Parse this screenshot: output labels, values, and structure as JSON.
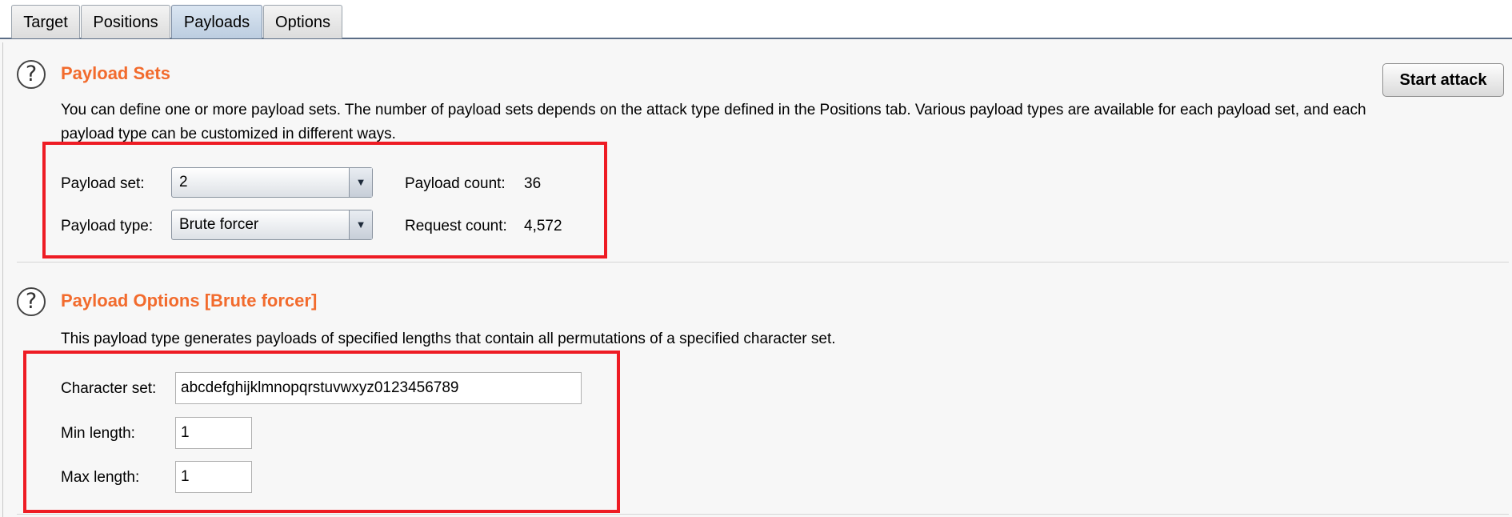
{
  "tabs": [
    {
      "label": "Target"
    },
    {
      "label": "Positions"
    },
    {
      "label": "Payloads",
      "active": true
    },
    {
      "label": "Options"
    }
  ],
  "start_attack_label": "Start attack",
  "payload_sets": {
    "title": "Payload Sets",
    "description": "You can define one or more payload sets. The number of payload sets depends on the attack type defined in the Positions tab. Various payload types are available for each payload set, and each payload type can be customized in different ways.",
    "payload_set_label": "Payload set:",
    "payload_set_value": "2",
    "payload_type_label": "Payload type:",
    "payload_type_value": "Brute forcer",
    "payload_count_label": "Payload count:",
    "payload_count_value": "36",
    "request_count_label": "Request count:",
    "request_count_value": "4,572"
  },
  "payload_options": {
    "title": "Payload Options [Brute forcer]",
    "description": "This payload type generates payloads of specified lengths that contain all permutations of a specified character set.",
    "character_set_label": "Character set:",
    "character_set_value": "abcdefghijklmnopqrstuvwxyz0123456789",
    "min_length_label": "Min length:",
    "min_length_value": "1",
    "max_length_label": "Max length:",
    "max_length_value": "1"
  },
  "icons": {
    "help": "help-circle-icon",
    "dropdown": "chevron-down-icon"
  },
  "colors": {
    "section_title": "#f26b2d",
    "highlight": "#ee1c24",
    "tab_active": "#bccde0"
  }
}
